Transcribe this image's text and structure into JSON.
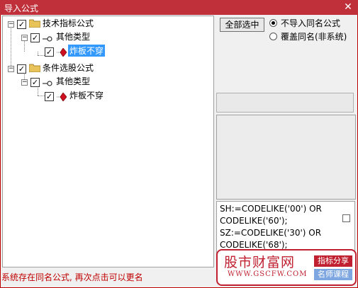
{
  "window": {
    "title": "导入公式",
    "close_symbol": "✕"
  },
  "tree": {
    "groups": [
      {
        "label": "技术指标公式",
        "sub_label": "其他类型",
        "leaf_label": "炸板不穿",
        "leaf_selected": true
      },
      {
        "label": "条件选股公式",
        "sub_label": "其他类型",
        "leaf_label": "炸板不穿",
        "leaf_selected": false
      }
    ]
  },
  "controls": {
    "select_all_label": "全部选中",
    "radio_options": [
      {
        "label": "不导入同名公式",
        "selected": true
      },
      {
        "label": "覆盖同名(非系统)",
        "selected": false
      }
    ]
  },
  "code": {
    "lines": [
      "SH:=CODELIKE('00') OR",
      "CODELIKE('60');",
      "SZ:=CODELIKE('30') OR",
      "CODELIKE('68');"
    ]
  },
  "status_text": "系统存在同名公式, 再次点击可以更名",
  "watermark": {
    "title": "股市财富网",
    "url": "WWW.GSCFW.COM",
    "tag1": "指标分享",
    "tag2": "名师课程"
  },
  "colors": {
    "titlebar": "#c0303a",
    "selection": "#3399ff",
    "status": "#c00000"
  }
}
